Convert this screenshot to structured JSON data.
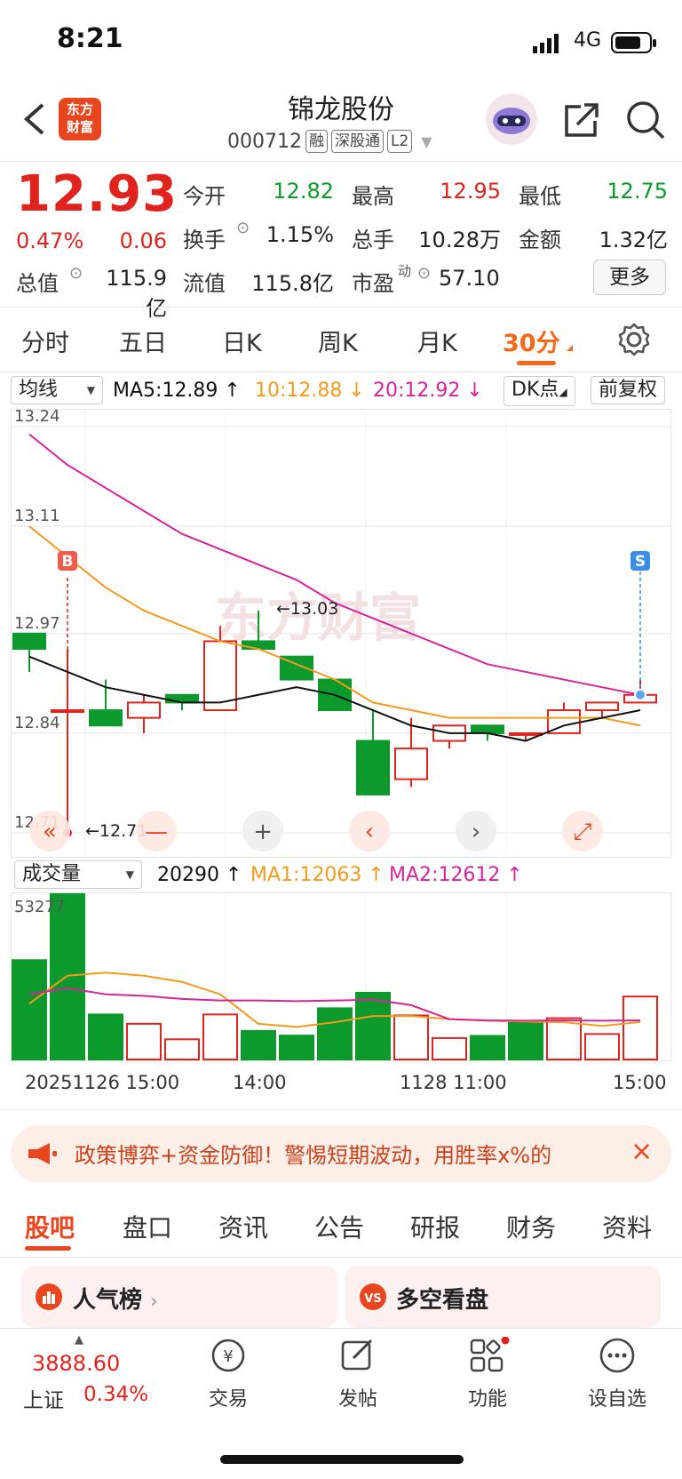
{
  "status": {
    "time": "8:21",
    "network": "4G"
  },
  "header": {
    "title": "锦龙股份",
    "code": "000712",
    "tags": [
      "融",
      "深股通",
      "L2"
    ],
    "logo_text_1": "东方",
    "logo_text_2": "财富"
  },
  "quote": {
    "price": "12.93",
    "change_pct": "0.47%",
    "change": "0.06",
    "fields": [
      {
        "label": "今开",
        "value": "12.82",
        "tone": "green"
      },
      {
        "label": "最高",
        "value": "12.95",
        "tone": "red"
      },
      {
        "label": "最低",
        "value": "12.75",
        "tone": "green"
      },
      {
        "label": "换手",
        "value": "1.15%",
        "tone": "plain"
      },
      {
        "label": "总手",
        "value": "10.28万",
        "tone": "plain"
      },
      {
        "label": "金额",
        "value": "1.32亿",
        "tone": "plain"
      },
      {
        "label": "总值",
        "value": "115.9亿",
        "tone": "plain"
      },
      {
        "label": "流值",
        "value": "115.8亿",
        "tone": "plain"
      },
      {
        "label": "市盈",
        "value": "57.10",
        "tone": "plain"
      }
    ],
    "pe_superscript": "动",
    "more_label": "更多"
  },
  "period_tabs": [
    "分时",
    "五日",
    "日K",
    "周K",
    "月K",
    "30分"
  ],
  "active_period": "30分",
  "indicator_row": {
    "select": "均线",
    "ma5": "MA5:12.89",
    "ma10": "10:12.88",
    "ma20": "20:12.92",
    "dk_label": "DK点",
    "adjust_label": "前复权"
  },
  "colors": {
    "up": "#e0231c",
    "down": "#0c9a2c",
    "ma5": "#111111",
    "ma10": "#f59a1b",
    "ma20": "#d8239a",
    "accent": "#f26a1b"
  },
  "chart_data": [
    {
      "type": "candlestick",
      "y_ticks": [
        "13.24",
        "13.11",
        "12.97",
        "12.84",
        "12.71"
      ],
      "ylim": [
        12.71,
        13.24
      ],
      "annotations": {
        "high": "←13.03",
        "low": "←12.71",
        "buy": "B",
        "sell": "S"
      },
      "candles": [
        {
          "o": 12.97,
          "c": 12.95,
          "h": 12.97,
          "l": 12.92
        },
        {
          "o": 12.87,
          "c": 12.87,
          "h": 12.95,
          "l": 12.71
        },
        {
          "o": 12.87,
          "c": 12.85,
          "h": 12.91,
          "l": 12.85
        },
        {
          "o": 12.86,
          "c": 12.88,
          "h": 12.89,
          "l": 12.84
        },
        {
          "o": 12.89,
          "c": 12.88,
          "h": 12.89,
          "l": 12.87
        },
        {
          "o": 12.87,
          "c": 12.96,
          "h": 12.98,
          "l": 12.87
        },
        {
          "o": 12.96,
          "c": 12.95,
          "h": 13.0,
          "l": 12.95
        },
        {
          "o": 12.94,
          "c": 12.91,
          "h": 12.94,
          "l": 12.91
        },
        {
          "o": 12.91,
          "c": 12.87,
          "h": 12.91,
          "l": 12.87
        },
        {
          "o": 12.83,
          "c": 12.76,
          "h": 12.87,
          "l": 12.76
        },
        {
          "o": 12.78,
          "c": 12.82,
          "h": 12.86,
          "l": 12.77
        },
        {
          "o": 12.83,
          "c": 12.85,
          "h": 12.85,
          "l": 12.82
        },
        {
          "o": 12.85,
          "c": 12.84,
          "h": 12.85,
          "l": 12.83
        },
        {
          "o": 12.84,
          "c": 12.84,
          "h": 12.84,
          "l": 12.83
        },
        {
          "o": 12.84,
          "c": 12.87,
          "h": 12.88,
          "l": 12.84
        },
        {
          "o": 12.87,
          "c": 12.88,
          "h": 12.88,
          "l": 12.86
        },
        {
          "o": 12.88,
          "c": 12.89,
          "h": 12.91,
          "l": 12.88
        }
      ],
      "ma5": [
        12.94,
        12.92,
        12.9,
        12.89,
        12.88,
        12.88,
        12.89,
        12.9,
        12.89,
        12.87,
        12.85,
        12.84,
        12.84,
        12.83,
        12.85,
        12.86,
        12.87
      ],
      "ma10": [
        13.11,
        13.07,
        13.03,
        13.0,
        12.98,
        12.96,
        12.95,
        12.93,
        12.91,
        12.88,
        12.87,
        12.86,
        12.86,
        12.86,
        12.86,
        12.86,
        12.85
      ],
      "ma20": [
        13.23,
        13.19,
        13.16,
        13.13,
        13.1,
        13.08,
        13.06,
        13.04,
        13.01,
        12.99,
        12.97,
        12.95,
        12.93,
        12.92,
        12.91,
        12.9,
        12.89
      ]
    },
    {
      "type": "bar",
      "y_max_label": "53277",
      "ylim": [
        0,
        53277
      ],
      "series_label": "成交量",
      "vol_now": "20290",
      "ma1": "MA1:12063",
      "ma2": "MA2:12612",
      "values": [
        32000,
        53277,
        14500,
        11500,
        6500,
        14500,
        9200,
        7700,
        16500,
        21500,
        14200,
        6900,
        7600,
        12300,
        13300,
        8200,
        20290
      ],
      "up": [
        false,
        false,
        false,
        true,
        true,
        true,
        false,
        false,
        false,
        false,
        true,
        true,
        false,
        false,
        true,
        true,
        true
      ],
      "ma1_line": [
        18000,
        27000,
        28000,
        27000,
        25000,
        21000,
        11500,
        10500,
        12000,
        14000,
        14000,
        13000,
        12500,
        12200,
        12000,
        10800,
        12063
      ],
      "ma2_line": [
        21000,
        23000,
        21000,
        20500,
        19500,
        19000,
        19000,
        18800,
        19000,
        19300,
        17500,
        13000,
        12600,
        12500,
        12600,
        12500,
        12612
      ]
    }
  ],
  "x_labels": [
    "20251126 15:00",
    "14:00",
    "1128 11:00",
    "15:00"
  ],
  "banner": {
    "text": "政策博弈+资金防御！警惕短期波动，用胜率x%的"
  },
  "bottom_tabs": [
    "股吧",
    "盘口",
    "资讯",
    "公告",
    "研报",
    "财务",
    "资料"
  ],
  "cards": [
    {
      "title": "人气榜"
    },
    {
      "title": "多空看盘"
    }
  ],
  "index": {
    "value": "3888.60",
    "name": "上证",
    "change": "0.34%"
  },
  "nav": [
    "交易",
    "发帖",
    "功能",
    "设自选"
  ]
}
